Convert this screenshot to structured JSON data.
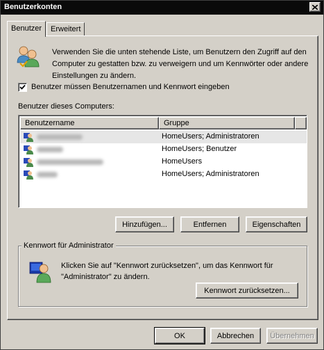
{
  "window": {
    "title": "Benutzerkonten"
  },
  "tabs": [
    {
      "label": "Benutzer"
    },
    {
      "label": "Erweitert"
    }
  ],
  "intro": {
    "text": "Verwenden Sie die unten stehende Liste, um Benutzern den Zugriff auf den Computer zu gestatten bzw. zu verweigern und um Kennwörter oder andere Einstellungen zu ändern."
  },
  "require_login": {
    "label": "Benutzer müssen Benutzernamen und Kennwort eingeben",
    "checked": true
  },
  "users_list": {
    "label": "Benutzer dieses Computers:",
    "columns": [
      "Benutzername",
      "Gruppe"
    ],
    "rows": [
      {
        "username": "",
        "group": "HomeUsers; Administratoren",
        "selected": true
      },
      {
        "username": "",
        "group": "HomeUsers; Benutzer",
        "selected": false
      },
      {
        "username": "",
        "group": "HomeUsers",
        "selected": false
      },
      {
        "username": "",
        "group": "HomeUsers; Administratoren",
        "selected": false
      }
    ]
  },
  "list_buttons": {
    "add": "Hinzufügen...",
    "remove": "Entfernen",
    "properties": "Eigenschaften"
  },
  "admin_password": {
    "title": "Kennwort für Administrator",
    "text": "Klicken Sie auf \"Kennwort zurücksetzen\", um das Kennwort für \"Administrator\" zu ändern.",
    "reset_button": "Kennwort zurücksetzen..."
  },
  "dialog_buttons": {
    "ok": "OK",
    "cancel": "Abbrechen",
    "apply": "Übernehmen"
  },
  "icons": {
    "close": "close-icon",
    "users": "users-icon",
    "user": "user-icon",
    "admin": "user-icon"
  }
}
